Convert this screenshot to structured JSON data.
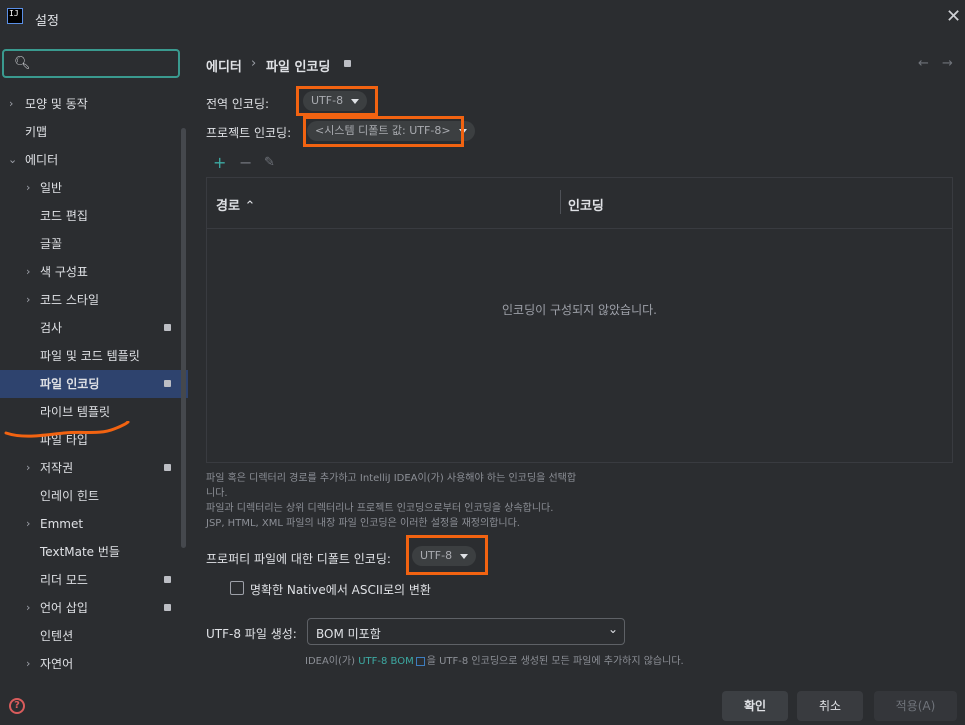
{
  "window": {
    "title": "설정",
    "app_icon_text": "IJ"
  },
  "sidebar": {
    "items": [
      {
        "label": "모양 및 동작",
        "chevron": "right"
      },
      {
        "label": "키맵"
      },
      {
        "label": "에디터",
        "chevron": "down"
      },
      {
        "label": "일반",
        "chevron": "right"
      },
      {
        "label": "코드 편집"
      },
      {
        "label": "글꼴"
      },
      {
        "label": "색 구성표",
        "chevron": "right"
      },
      {
        "label": "코드 스타일",
        "chevron": "right"
      },
      {
        "label": "검사"
      },
      {
        "label": "파일 및 코드 템플릿"
      },
      {
        "label": "파일 인코딩",
        "selected": true
      },
      {
        "label": "라이브 템플릿"
      },
      {
        "label": "파일 타입"
      },
      {
        "label": "저작권",
        "chevron": "right"
      },
      {
        "label": "인레이 힌트"
      },
      {
        "label": "Emmet",
        "chevron": "right"
      },
      {
        "label": "TextMate 번들"
      },
      {
        "label": "리더 모드"
      },
      {
        "label": "언어 삽입",
        "chevron": "right"
      },
      {
        "label": "인텐션"
      },
      {
        "label": "자연어",
        "chevron": "right"
      }
    ]
  },
  "breadcrumb": {
    "parent": "에디터",
    "current": "파일 인코딩"
  },
  "global_encoding": {
    "label": "전역 인코딩:",
    "value": "UTF-8"
  },
  "project_encoding": {
    "label": "프로젝트 인코딩:",
    "value": "<시스템 디폴트 값: UTF-8>"
  },
  "table": {
    "columns": [
      "경로",
      "인코딩"
    ],
    "empty_text": "인코딩이 구성되지 않았습니다."
  },
  "description": {
    "line1": "파일 혹은 디렉터리 경로를 추가하고 IntelliJ IDEA이(가) 사용해야 하는 인코딩을 선택합",
    "line2": "니다.",
    "line3": "파일과 디렉터리는 상위 디렉터리나 프로젝트 인코딩으로부터 인코딩을 상속합니다.",
    "line4": "JSP, HTML, XML 파일의 내장 파일 인코딩은 이러한 설정을 재정의합니다."
  },
  "properties_encoding": {
    "label": "프로퍼티 파일에 대한 디폴트 인코딩:",
    "value": "UTF-8"
  },
  "native_to_ascii": {
    "label": "명확한 Native에서 ASCII로의 변환",
    "checked": false
  },
  "bom": {
    "label": "UTF-8 파일 생성:",
    "value": "BOM 미포함",
    "note_prefix": "IDEA이(가)",
    "note_link": "UTF-8 BOM",
    "note_suffix": "을 UTF-8 인코딩으로 생성된 모든 파일에 추가하지 않습니다."
  },
  "buttons": {
    "ok": "확인",
    "cancel": "취소",
    "apply": "적용(A)"
  },
  "colors": {
    "highlight": "#f26311",
    "selection": "#2e436e",
    "link": "#3daaa3",
    "search_border": "#3a9a8f"
  }
}
